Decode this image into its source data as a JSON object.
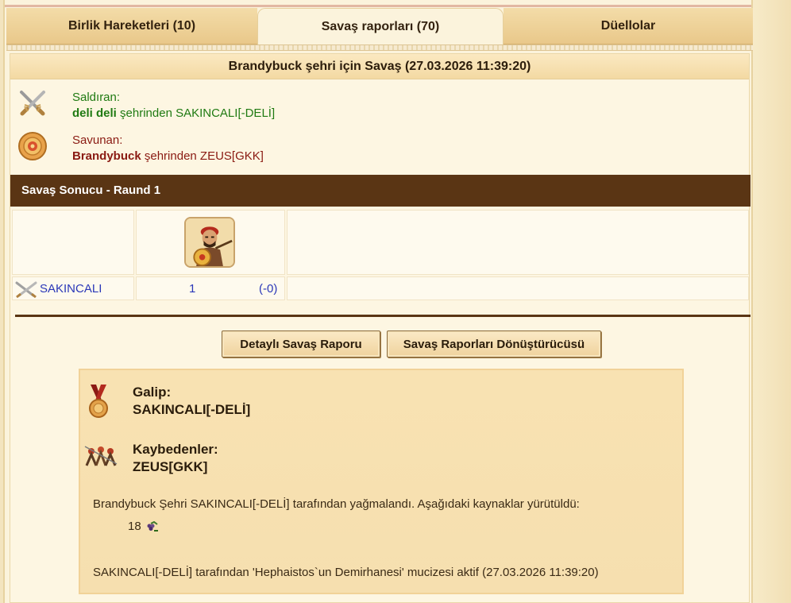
{
  "tabs": [
    {
      "label": "Birlik Hareketleri (10)"
    },
    {
      "label": "Savaş raporları (70)"
    },
    {
      "label": "Düellolar"
    }
  ],
  "report": {
    "title": "Brandybuck şehri için Savaş (27.03.2026 11:39:20)",
    "attacker": {
      "label": "Saldıran:",
      "city": "deli deli",
      "city_suffix": "şehrinden SAKINCALI[-DELİ]"
    },
    "defender": {
      "label": "Savunan:",
      "city": "Brandybuck",
      "city_suffix": "şehrinden ZEUS[GKK]"
    },
    "result_bar": "Savaş Sonucu - Raund 1",
    "unit_row": {
      "player": "SAKINCALI",
      "count": "1",
      "loss": "(-0)"
    },
    "buttons": {
      "detailed": "Detaylı Savaş Raporu",
      "converter": "Savaş Raporları Dönüştürücüsü"
    },
    "summary": {
      "winner_label": "Galip:",
      "winner": "SAKINCALI[-DELİ]",
      "losers_label": "Kaybedenler:",
      "losers": "ZEUS[GKK]",
      "plunder_text": "Brandybuck Şehri SAKINCALI[-DELİ] tarafından yağmalandı. Aşağıdaki kaynaklar yürütüldü:",
      "resource_amount": "18",
      "miracle_text": "SAKINCALI[-DELİ] tarafından 'Hephaistos`un Demirhanesi' mucizesi aktif (27.03.2026 11:39:20)"
    }
  },
  "colors": {
    "attacker_text": "#1f7a12",
    "defender_text": "#8a1a12",
    "result_bar_bg": "#5a3514",
    "link_blue": "#2a37b8"
  }
}
